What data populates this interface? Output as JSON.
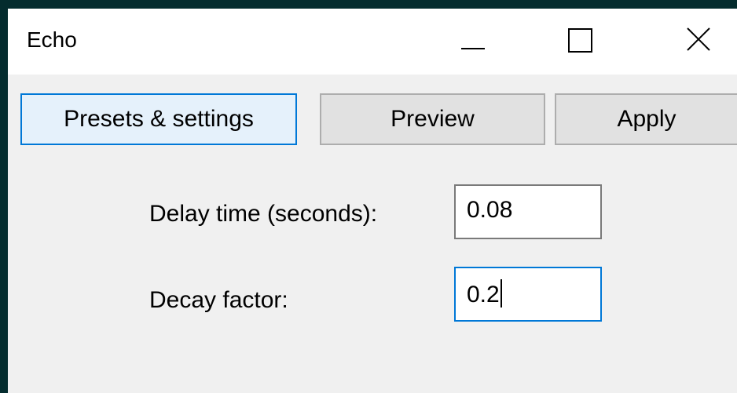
{
  "window": {
    "title": "Echo"
  },
  "controls": {
    "minimize_icon": "minimize-icon",
    "maximize_icon": "maximize-icon",
    "close_icon": "close-icon"
  },
  "toolbar": {
    "presets_label": "Presets & settings",
    "preview_label": "Preview",
    "apply_label": "Apply"
  },
  "form": {
    "delay": {
      "label": "Delay time (seconds):",
      "value": "0.08"
    },
    "decay": {
      "label": "Decay factor:",
      "value": "0.2"
    }
  },
  "colors": {
    "desktop": "#042c2e",
    "window_bg": "#f0f0f0",
    "accent": "#0078d7"
  }
}
